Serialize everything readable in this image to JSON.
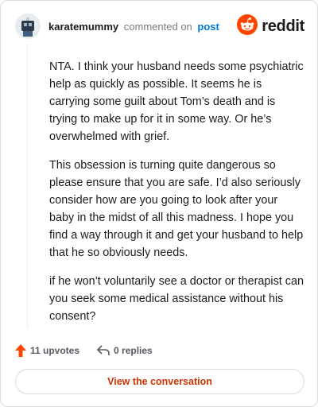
{
  "header": {
    "username": "karatemummy",
    "action": "commented on",
    "target": "post",
    "brand": "reddit"
  },
  "comment": {
    "paragraphs": [
      "NTA. I think your husband needs some psychiatric help as quickly as possible. It seems he is carrying some guilt about Tom’s death and is trying to make up for it in some way. Or he’s overwhelmed with grief.",
      "This obsession is turning quite dangerous so please ensure that you are safe. I’d also seriously consider how are you going to look after your baby in the midst of all this madness. I hope you find a way through it and get your husband to help that he so obviously needs.",
      "if he won’t voluntarily see a doctor or therapist can you seek some medical assistance without his consent?"
    ]
  },
  "footer": {
    "upvotes": "11 upvotes",
    "replies": "0 replies",
    "cta": "View the conversation"
  },
  "colors": {
    "brand": "#ff4500",
    "upvote": "#ff4500",
    "link": "#0079d3",
    "cta": "#cc3300"
  },
  "icons": {
    "avatar": "user-avatar",
    "brand": "reddit-snoo-icon",
    "upvote": "upvote-arrow-icon",
    "reply": "reply-arrow-icon"
  }
}
